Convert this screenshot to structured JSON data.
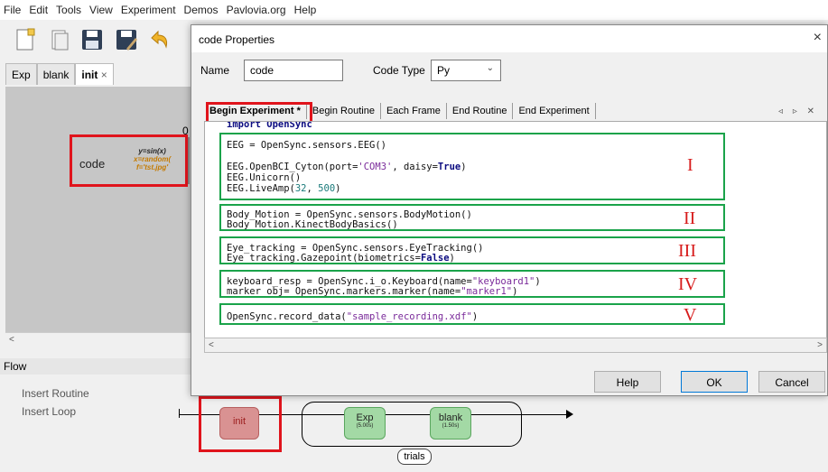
{
  "menu": [
    "File",
    "Edit",
    "Tools",
    "View",
    "Experiment",
    "Demos",
    "Pavlovia.org",
    "Help"
  ],
  "routine_tabs": [
    {
      "label": "Exp"
    },
    {
      "label": "blank"
    },
    {
      "label": "init",
      "close": "×"
    }
  ],
  "routine_canvas": {
    "component_name": "code",
    "annotation": [
      "y=sin(x)",
      "x=random(",
      "f='tst.jpg'"
    ],
    "partial_text": "0"
  },
  "flow": {
    "label": "Flow",
    "insert_routine": "Insert Routine",
    "insert_loop": "Insert Loop",
    "routines": [
      {
        "name": "init",
        "duration": ""
      },
      {
        "name": "Exp",
        "duration": "(5.00s)"
      },
      {
        "name": "blank",
        "duration": "(1.50s)"
      }
    ],
    "loop_name": "trials"
  },
  "dialog": {
    "title": "code Properties",
    "close": "×",
    "name_label": "Name",
    "name_value": "code",
    "code_type_label": "Code Type",
    "code_type_value": "Py",
    "tabs": [
      "Begin Experiment *",
      "Begin Routine",
      "Each Frame",
      "End Routine",
      "End Experiment"
    ],
    "tab_arrows": "◃ ▹ ✕",
    "code": {
      "import": "import OpenSync",
      "eeg1": "EEG = OpenSync.sensors.EEG()",
      "eeg2a": "EEG.OpenBCI_Cyton(port=",
      "eeg2s": "'COM3'",
      "eeg2b": ", daisy=",
      "eeg2k": "True",
      "eeg2c": ")",
      "eeg3": "EEG.Unicorn()",
      "eeg4a": "EEG.LiveAmp(",
      "eeg4n1": "32",
      "eeg4b": ", ",
      "eeg4n2": "500",
      "eeg4c": ")",
      "body1": "Body_Motion = OpenSync.sensors.BodyMotion()",
      "body2": "Body_Motion.KinectBodyBasics()",
      "eye1": "Eye_tracking = OpenSync.sensors.EyeTracking()",
      "eye2a": "Eye_tracking.Gazepoint(biometrics=",
      "eye2k": "False",
      "eye2b": ")",
      "kb1a": "keyboard_resp = OpenSync.i_o.Keyboard(name=",
      "kb1s": "\"keyboard1\"",
      "kb1b": ")",
      "kb2a": "marker_obj= OpenSync.markers.marker(name=",
      "kb2s": "\"marker1\"",
      "kb2b": ")",
      "rec_a": "OpenSync.record_data(",
      "rec_s": "\"sample_recording.xdf\"",
      "rec_b": ")"
    },
    "roman_labels": [
      "I",
      "II",
      "III",
      "IV",
      "V"
    ],
    "buttons": {
      "help": "Help",
      "ok": "OK",
      "cancel": "Cancel"
    }
  },
  "colors": {
    "highlight_red": "#e0141c",
    "section_green": "#1aa34a",
    "label_red": "#d71b1b"
  }
}
